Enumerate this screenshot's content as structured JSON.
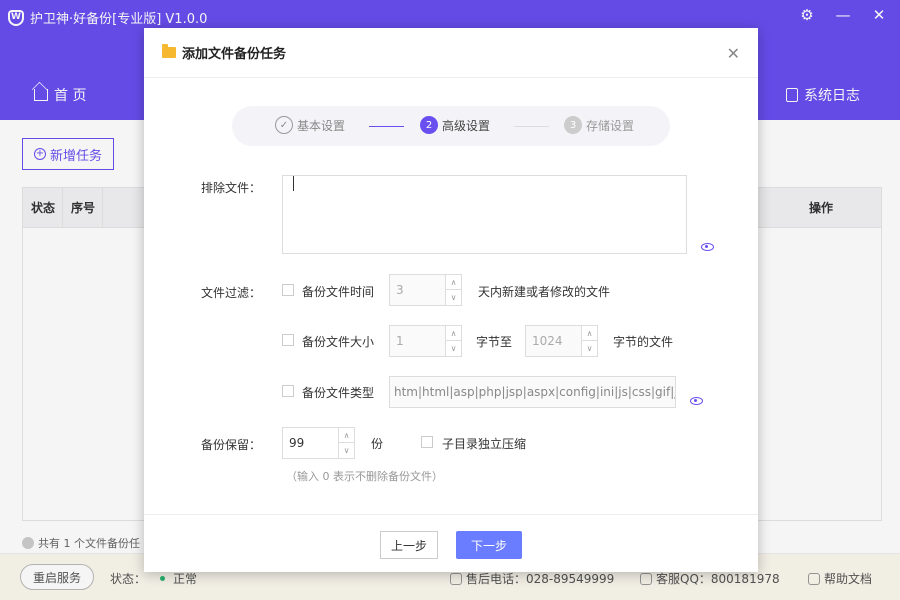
{
  "app": {
    "title": "护卫神·好备份[专业版]  V1.0.0",
    "logo_letter": "W",
    "controls": {
      "settings": "⚙",
      "minimize": "—",
      "close": "✕"
    }
  },
  "nav": {
    "home": "首  页",
    "log": "系统日志"
  },
  "main": {
    "add_task": "新增任务",
    "table": {
      "headers": {
        "status": "状态",
        "index": "序号",
        "operation": "操作"
      }
    },
    "footer_info": "共有 1 个文件备份任"
  },
  "status_bar": {
    "restart": "重启服务",
    "status_label": "状态：",
    "status_value": "正常",
    "phone": "售后电话：028-89549999",
    "qq": "客服QQ：800181978",
    "help": "帮助文档"
  },
  "modal": {
    "title": "添加文件备份任务",
    "steps": [
      {
        "num": "✓",
        "label": "基本设置"
      },
      {
        "num": "2",
        "label": "高级设置"
      },
      {
        "num": "3",
        "label": "存储设置"
      }
    ],
    "exclude_label": "排除文件：",
    "filter_label": "文件过滤：",
    "time": {
      "label": "备份文件时间",
      "value": "3",
      "suffix": "天内新建或者修改的文件"
    },
    "size": {
      "label": "备份文件大小",
      "from": "1",
      "mid": "字节至",
      "to": "1024",
      "suffix": "字节的文件"
    },
    "types": {
      "label": "备份文件类型",
      "value": "htm|html|asp|php|jsp|aspx|config|ini|js|css|gif|jp..."
    },
    "keep": {
      "label": "备份保留：",
      "value": "99",
      "unit": "份",
      "subdir_label": "子目录独立压缩"
    },
    "hint": "（输入 0 表示不删除备份文件）",
    "prev": "上一步",
    "next": "下一步"
  }
}
